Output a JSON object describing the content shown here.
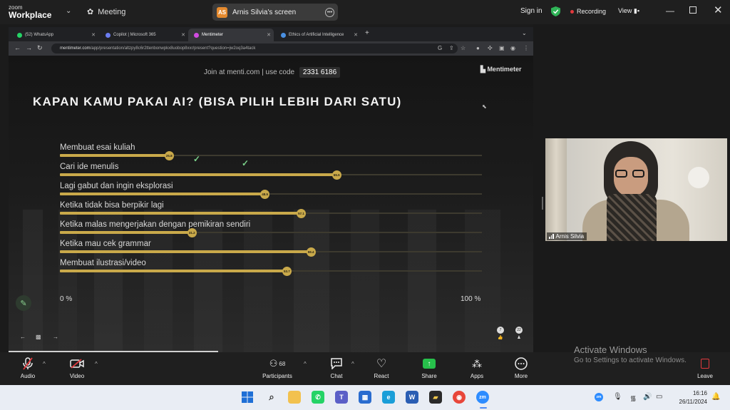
{
  "zoom": {
    "logo_small": "zoom",
    "logo_big": "Workplace",
    "meeting_label": "Meeting",
    "screen_avatar": "AS",
    "screen_label": "Arnis Silvia's screen",
    "sign_in": "Sign in",
    "recording_label": "Recording",
    "view_label": "View",
    "colors": {
      "bar": "#1f1f1f",
      "record": "#e2393d",
      "shield": "#2fb457"
    }
  },
  "browser": {
    "tabs": [
      {
        "label": "(52) WhatsApp",
        "icon": "whatsapp-icon",
        "color": "#25d366"
      },
      {
        "label": "Copilot | Microsoft 365",
        "icon": "copilot-icon",
        "color": "#6b7df0"
      },
      {
        "label": "Mentimeter",
        "icon": "mentimeter-icon",
        "color": "#d04ae0"
      },
      {
        "label": "Ethics of Artificial Intelligence",
        "icon": "globe-icon",
        "color": "#4a90e2"
      }
    ],
    "url_host": "mentimeter.com",
    "url_path": "/app/presentation/altzpy8c6r2ttenbonwpkx8uobop8xxr/present?question=jw2oq3a4tack"
  },
  "slide": {
    "join_text": "Join at menti.com | use code",
    "join_code": "2331 6186",
    "brand": "Mentimeter",
    "question": "KAPAN KAMU PAKAI AI? (BISA PILIH LEBIH DARI SATU)",
    "axis_min_label": "0 %",
    "axis_max_label": "100 %",
    "accent_color": "#c9a94a",
    "reactions_count": "7",
    "participants_count": "22",
    "options": [
      {
        "label": "Membuat esai kuliah",
        "value": 25.8,
        "value_label": "25.8"
      },
      {
        "label": "Cari ide menulis",
        "value": 65.5,
        "value_label": "65.5"
      },
      {
        "label": "Lagi gabut dan ingin eksplorasi",
        "value": 48.5,
        "value_label": "48.5"
      },
      {
        "label": "Ketika tidak bisa berpikir lagi",
        "value": 57.1,
        "value_label": "57.1"
      },
      {
        "label": "Ketika malas mengerjakan dengan pemikiran sendiri",
        "value": 31.2,
        "value_label": "31.2"
      },
      {
        "label": "Ketika mau cek grammar",
        "value": 59.4,
        "value_label": "59.4"
      },
      {
        "label": "Membuat ilustrasi/video",
        "value": 53.7,
        "value_label": "53.7"
      }
    ]
  },
  "webcam": {
    "name": "Arnis Silvia"
  },
  "watermark": {
    "title": "Activate Windows",
    "subtitle": "Go to Settings to activate Windows."
  },
  "toolbar": {
    "audio": "Audio",
    "video": "Video",
    "participants": "Participants",
    "participants_count": "68",
    "chat": "Chat",
    "react": "React",
    "share": "Share",
    "apps": "Apps",
    "more": "More",
    "leave": "Leave"
  },
  "taskbar": {
    "time": "16:16",
    "date": "26/11/2024"
  }
}
